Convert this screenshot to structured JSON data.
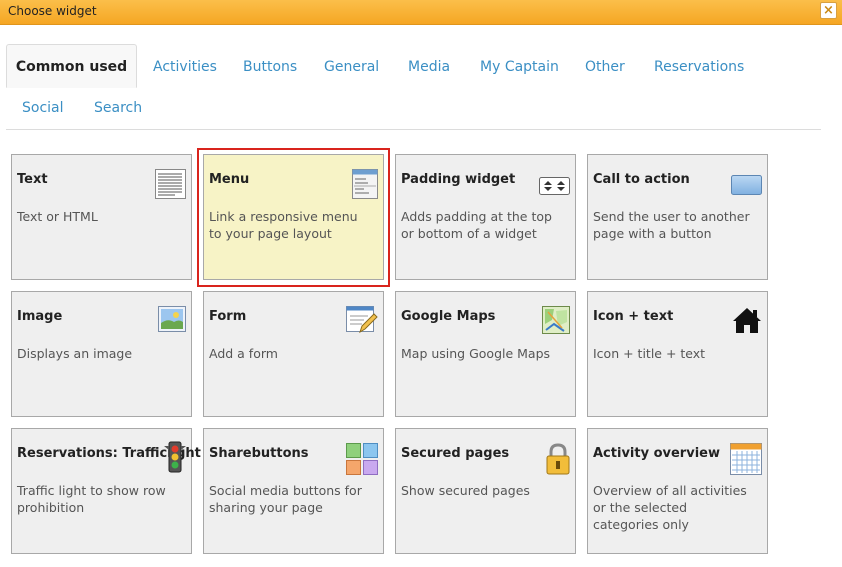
{
  "window": {
    "title": "Choose widget"
  },
  "tabs": [
    "Common used",
    "Activities",
    "Buttons",
    "General",
    "Media",
    "My Captain",
    "Other",
    "Reservations",
    "Social",
    "Search"
  ],
  "widgets": [
    {
      "title": "Text",
      "desc": "Text or HTML",
      "icon": "text-document-icon"
    },
    {
      "title": "Menu",
      "desc": "Link a responsive menu to your page layout",
      "icon": "menu-window-icon",
      "selected": true
    },
    {
      "title": "Padding widget",
      "desc": "Adds padding at the top or bottom of a widget",
      "icon": "padding-arrows-icon"
    },
    {
      "title": "Call to action",
      "desc": "Send the user to another page with a button",
      "icon": "button-icon"
    },
    {
      "title": "Image",
      "desc": "Displays an image",
      "icon": "landscape-image-icon"
    },
    {
      "title": "Form",
      "desc": "Add a form",
      "icon": "form-pencil-icon"
    },
    {
      "title": "Google Maps",
      "desc": "Map using Google Maps",
      "icon": "map-icon"
    },
    {
      "title": "Icon + text",
      "desc": "Icon + title + text",
      "icon": "home-icon"
    },
    {
      "title": "Reservations: Trafficlight",
      "desc": "Traffic light to show row prohibition",
      "icon": "traffic-light-icon"
    },
    {
      "title": "Sharebuttons",
      "desc": "Social media buttons for sharing your page",
      "icon": "share-grid-icon"
    },
    {
      "title": "Secured pages",
      "desc": "Show secured pages",
      "icon": "padlock-icon"
    },
    {
      "title": "Activity overview",
      "desc": "Overview of all activities or the selected categories only",
      "icon": "calendar-icon"
    }
  ]
}
